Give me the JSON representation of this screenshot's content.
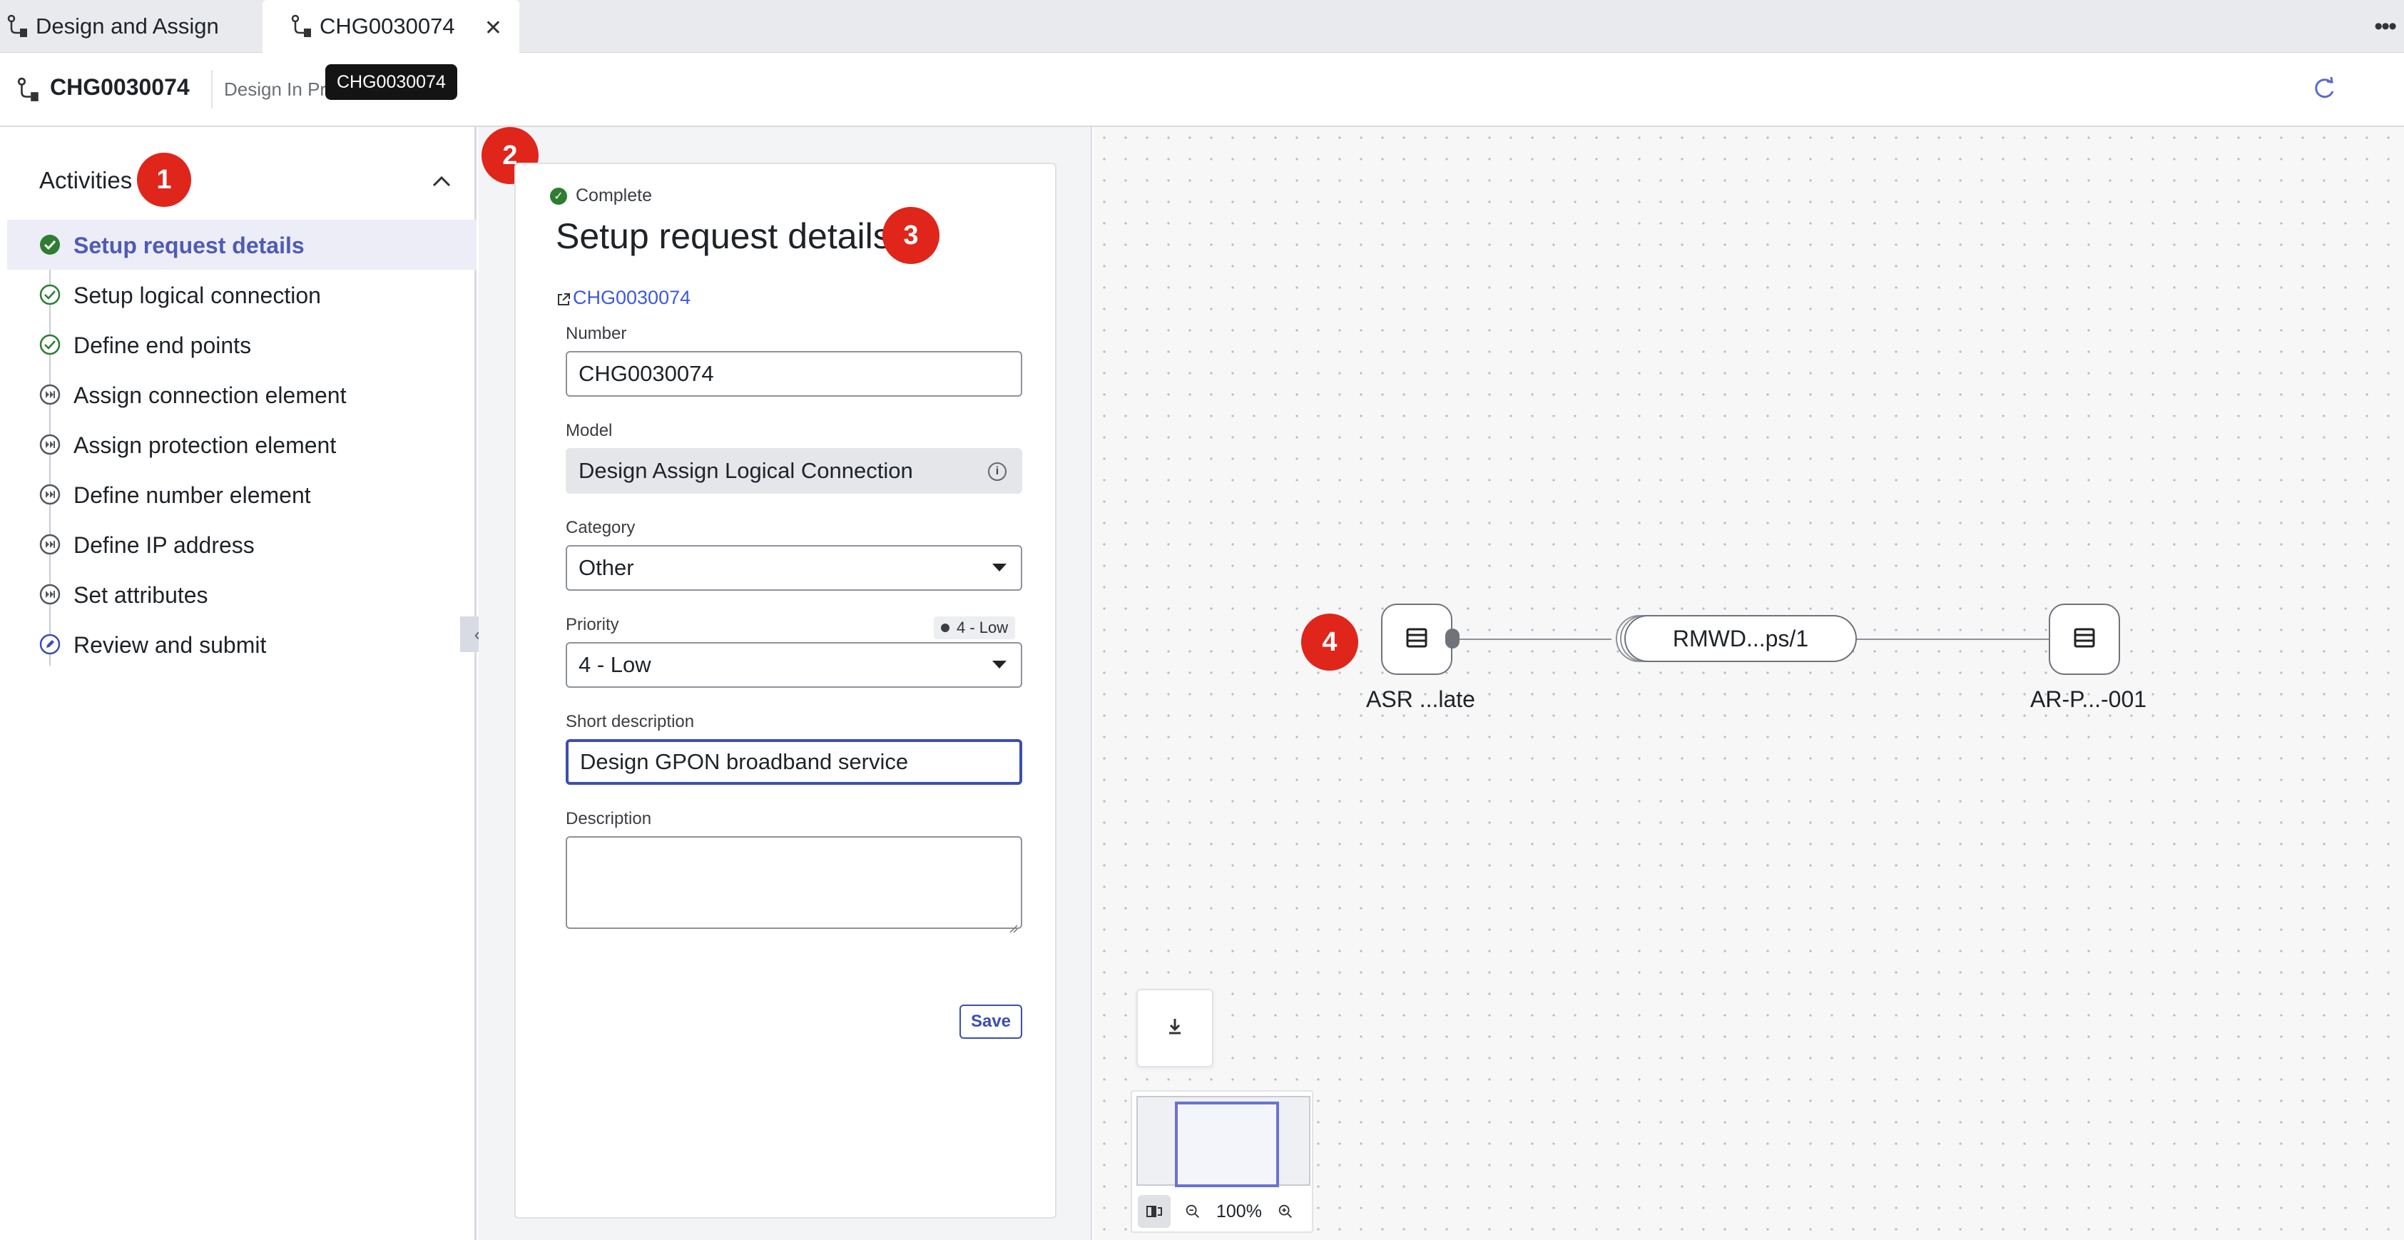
{
  "tabs": [
    {
      "label": "Design and Assign"
    },
    {
      "label": "CHG0030074"
    }
  ],
  "header": {
    "title": "CHG0030074",
    "state": "Design In Pr",
    "tooltip": "CHG0030074"
  },
  "activities": {
    "title": "Activities",
    "items": [
      {
        "label": "Setup request details",
        "status": "complete",
        "active": true
      },
      {
        "label": "Setup logical connection",
        "status": "complete-outline"
      },
      {
        "label": "Define end points",
        "status": "complete-outline"
      },
      {
        "label": "Assign connection element",
        "status": "skipped"
      },
      {
        "label": "Assign protection element",
        "status": "skipped"
      },
      {
        "label": "Define number element",
        "status": "skipped"
      },
      {
        "label": "Define IP address",
        "status": "skipped"
      },
      {
        "label": "Set attributes",
        "status": "skipped"
      },
      {
        "label": "Review and submit",
        "status": "pending"
      }
    ]
  },
  "badges": [
    "1",
    "2",
    "3",
    "4"
  ],
  "form": {
    "status": "Complete",
    "title": "Setup request details",
    "link": "CHG0030074",
    "number_label": "Number",
    "number_value": "CHG0030074",
    "model_label": "Model",
    "model_value": "Design Assign Logical Connection",
    "category_label": "Category",
    "category_value": "Other",
    "priority_label": "Priority",
    "priority_value": "4 - Low",
    "priority_tag": "4 - Low",
    "short_desc_label": "Short description",
    "short_desc_value": "Design GPON broadband service",
    "description_label": "Description",
    "description_value": "",
    "save_label": "Save"
  },
  "canvas": {
    "nodes": [
      {
        "label": "ASR ...late",
        "icon": "list-icon"
      },
      {
        "label": "AR-P...-001",
        "icon": "list-icon"
      }
    ],
    "link_label": "RMWD...ps/1",
    "zoom": "100%"
  },
  "colors": {
    "accent": "#3b4fb0",
    "badge": "#e0251b",
    "complete": "#2e7d32"
  }
}
